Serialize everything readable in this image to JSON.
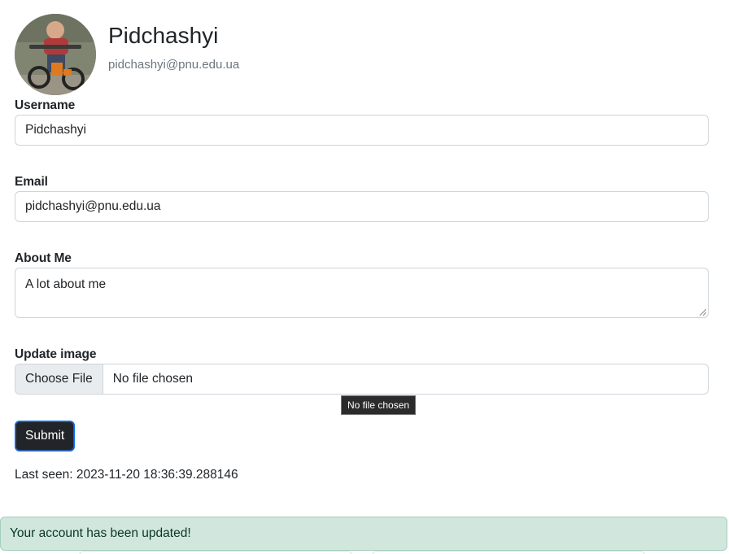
{
  "profile": {
    "name": "Pidchashyi",
    "email": "pidchashyi@pnu.edu.ua"
  },
  "form": {
    "username": {
      "label": "Username",
      "value": "Pidchashyi"
    },
    "email": {
      "label": "Email",
      "value": "pidchashyi@pnu.edu.ua"
    },
    "about": {
      "label": "About Me",
      "value": "A lot about me"
    },
    "image": {
      "label": "Update image",
      "button_label": "Choose File",
      "status": "No file chosen",
      "tooltip": "No file chosen"
    },
    "submit_label": "Submit"
  },
  "last_seen": "Last seen: 2023-11-20 18:36:39.288146",
  "alert": {
    "message": "Your account has been updated!",
    "color": "#d1e7dd"
  }
}
